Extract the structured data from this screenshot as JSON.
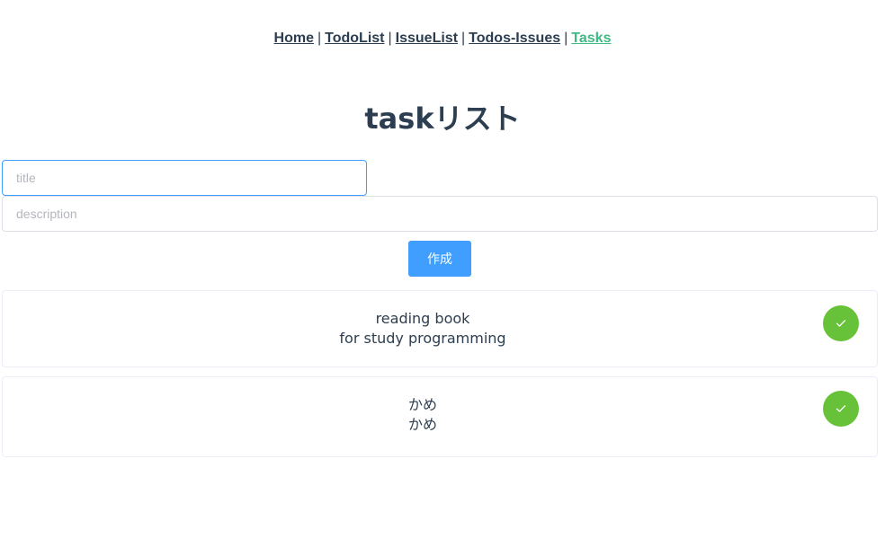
{
  "nav": {
    "items": [
      {
        "label": "Home"
      },
      {
        "label": "TodoList"
      },
      {
        "label": "IssueList"
      },
      {
        "label": "Todos-Issues"
      },
      {
        "label": "Tasks"
      }
    ],
    "separator": "|",
    "active_color": "#42b983"
  },
  "page": {
    "title": "taskリスト"
  },
  "form": {
    "title_placeholder": "title",
    "description_placeholder": "description",
    "create_label": "作成",
    "button_color": "#409eff"
  },
  "tasks": [
    {
      "title": "reading book",
      "description": "for study programming"
    },
    {
      "title": "かめ",
      "description": "かめ"
    }
  ],
  "icons": {
    "complete": "check-icon",
    "complete_color": "#67c23a"
  }
}
